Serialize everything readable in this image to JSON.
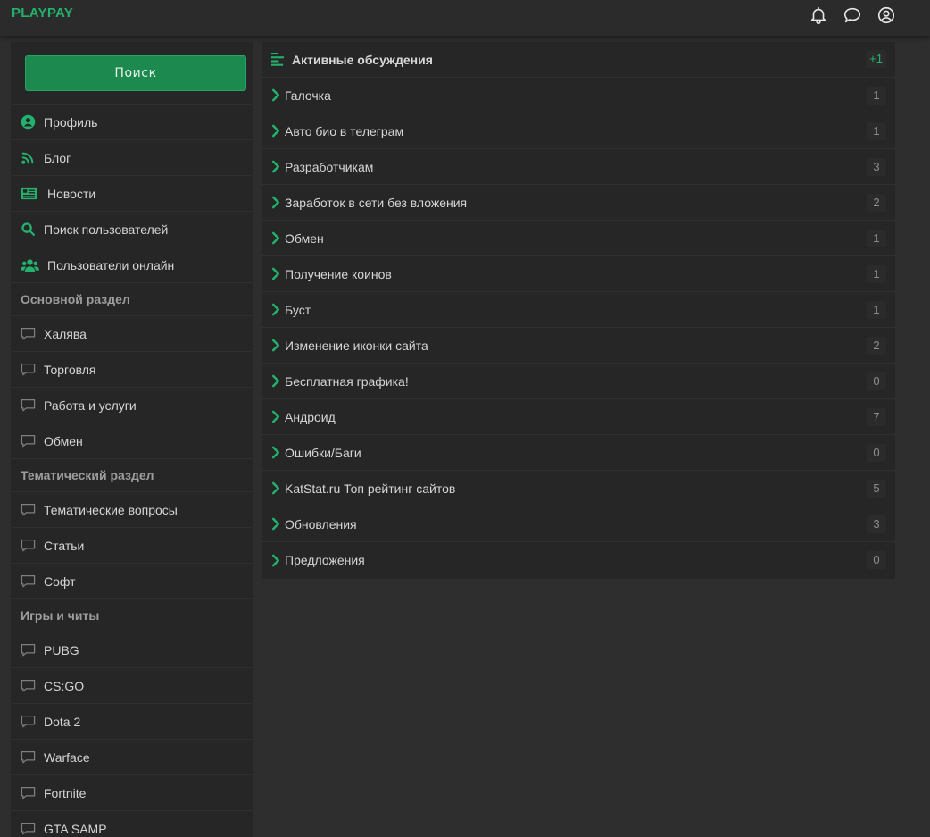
{
  "header": {
    "logo": "PLAYPAY",
    "icons": [
      "bell-icon",
      "chat-icon",
      "user-circle-icon"
    ]
  },
  "colors": {
    "accent": "#23b26d",
    "button_bg": "#1c8a4f",
    "panel_bg": "#262626",
    "page_bg": "#2e2e2e",
    "muted": "#9d9d9d"
  },
  "sidebar": {
    "search_label": "Поиск",
    "main_links": [
      {
        "label": "Профиль",
        "icon": "user-circle-solid-icon"
      },
      {
        "label": "Блог",
        "icon": "rss-icon"
      },
      {
        "label": "Новости",
        "icon": "newspaper-icon"
      },
      {
        "label": "Поиск пользователей",
        "icon": "search-icon"
      },
      {
        "label": "Пользователи онлайн",
        "icon": "users-icon"
      }
    ],
    "sections": [
      {
        "title": "Основной раздел",
        "items": [
          "Халява",
          "Торговля",
          "Работа и услуги",
          "Обмен"
        ]
      },
      {
        "title": "Тематический раздел",
        "items": [
          "Тематические вопросы",
          "Статьи",
          "Софт"
        ]
      },
      {
        "title": "Игры и читы",
        "items": [
          "PUBG",
          "CS:GO",
          "Dota 2",
          "Warface",
          "Fortnite",
          "GTA SAMP"
        ]
      }
    ]
  },
  "discussions": {
    "title": "Активные обсуждения",
    "badge": "+1",
    "topics": [
      {
        "title": "Галочка",
        "count": "1"
      },
      {
        "title": "Авто био в телеграм",
        "count": "1"
      },
      {
        "title": "Разработчикам",
        "count": "3"
      },
      {
        "title": "Заработок в сети без вложения",
        "count": "2"
      },
      {
        "title": "Обмен",
        "count": "1"
      },
      {
        "title": "Получение коинов",
        "count": "1"
      },
      {
        "title": "Буст",
        "count": "1"
      },
      {
        "title": "Изменение иконки сайта",
        "count": "2"
      },
      {
        "title": "Бесплатная графика!",
        "count": "0"
      },
      {
        "title": "Андроид",
        "count": "7"
      },
      {
        "title": "Ошибки/Баги",
        "count": "0"
      },
      {
        "title": "KatStat.ru Топ рейтинг сайтов",
        "count": "5"
      },
      {
        "title": "Обновления",
        "count": "3"
      },
      {
        "title": "Предложения",
        "count": "0"
      }
    ]
  }
}
